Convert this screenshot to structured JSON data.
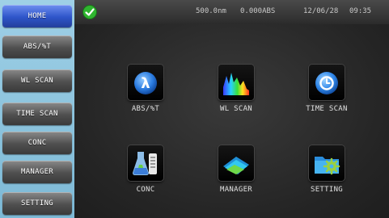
{
  "sidebar": {
    "items": [
      {
        "label": "HOME"
      },
      {
        "label": "ABS/%T"
      },
      {
        "label": "WL SCAN"
      },
      {
        "label": "TIME SCAN"
      },
      {
        "label": "CONC"
      },
      {
        "label": "MANAGER"
      },
      {
        "label": "SETTING"
      }
    ]
  },
  "status": {
    "wavelength": "500.0nm",
    "absorbance": "0.000ABS",
    "date": "12/06/28",
    "time": "09:35"
  },
  "tiles": [
    {
      "label": "ABS/%T",
      "icon": "lambda-icon"
    },
    {
      "label": "WL SCAN",
      "icon": "spectrum-icon"
    },
    {
      "label": "TIME SCAN",
      "icon": "clock-icon"
    },
    {
      "label": "CONC",
      "icon": "flask-icon"
    },
    {
      "label": "MANAGER",
      "icon": "folder-icon"
    },
    {
      "label": "SETTING",
      "icon": "settings-folder-icon"
    }
  ],
  "colors": {
    "sidebar_bg": "#8cc4de",
    "active_button": "#2e55c9",
    "check_green": "#2fb52f"
  }
}
